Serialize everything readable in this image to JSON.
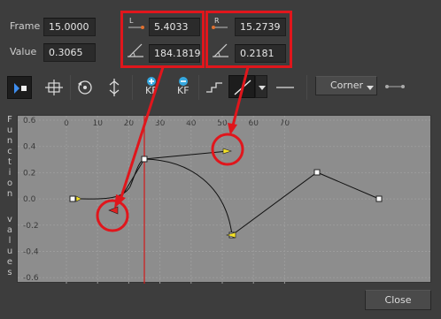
{
  "fields": {
    "frame_label": "Frame",
    "frame_value": "15.0000",
    "value_label": "Value",
    "value_value": "0.3065",
    "left_tag": "L",
    "left_frame": "5.4033",
    "left_angle": "184.1819",
    "right_tag": "R",
    "right_frame": "15.2739",
    "right_angle": "0.2181"
  },
  "toolbar": {
    "add_kf_label": "KF",
    "remove_kf_label": "KF",
    "interpolation_value": "Corner"
  },
  "graph": {
    "side_label_top": [
      "F",
      "u",
      "n",
      "c",
      "t",
      "i",
      "o",
      "n"
    ],
    "side_label_bottom": [
      "v",
      "a",
      "l",
      "u",
      "e",
      "s"
    ],
    "x_ticks": [
      "0",
      "10",
      "20",
      "30",
      "40",
      "50",
      "60",
      "70"
    ],
    "y_ticks": [
      "0.6",
      "0.4",
      "0.2",
      "0.0",
      "-0.2",
      "-0.4",
      "-0.6"
    ]
  },
  "footer": {
    "close_label": "Close"
  },
  "colors": {
    "annotation_red": "#e0161c",
    "handle_yellow": "#f2e02a",
    "handle_red": "#e02020",
    "graph_bg": "#8d8d8d",
    "frame_line": "#d21a1a"
  }
}
